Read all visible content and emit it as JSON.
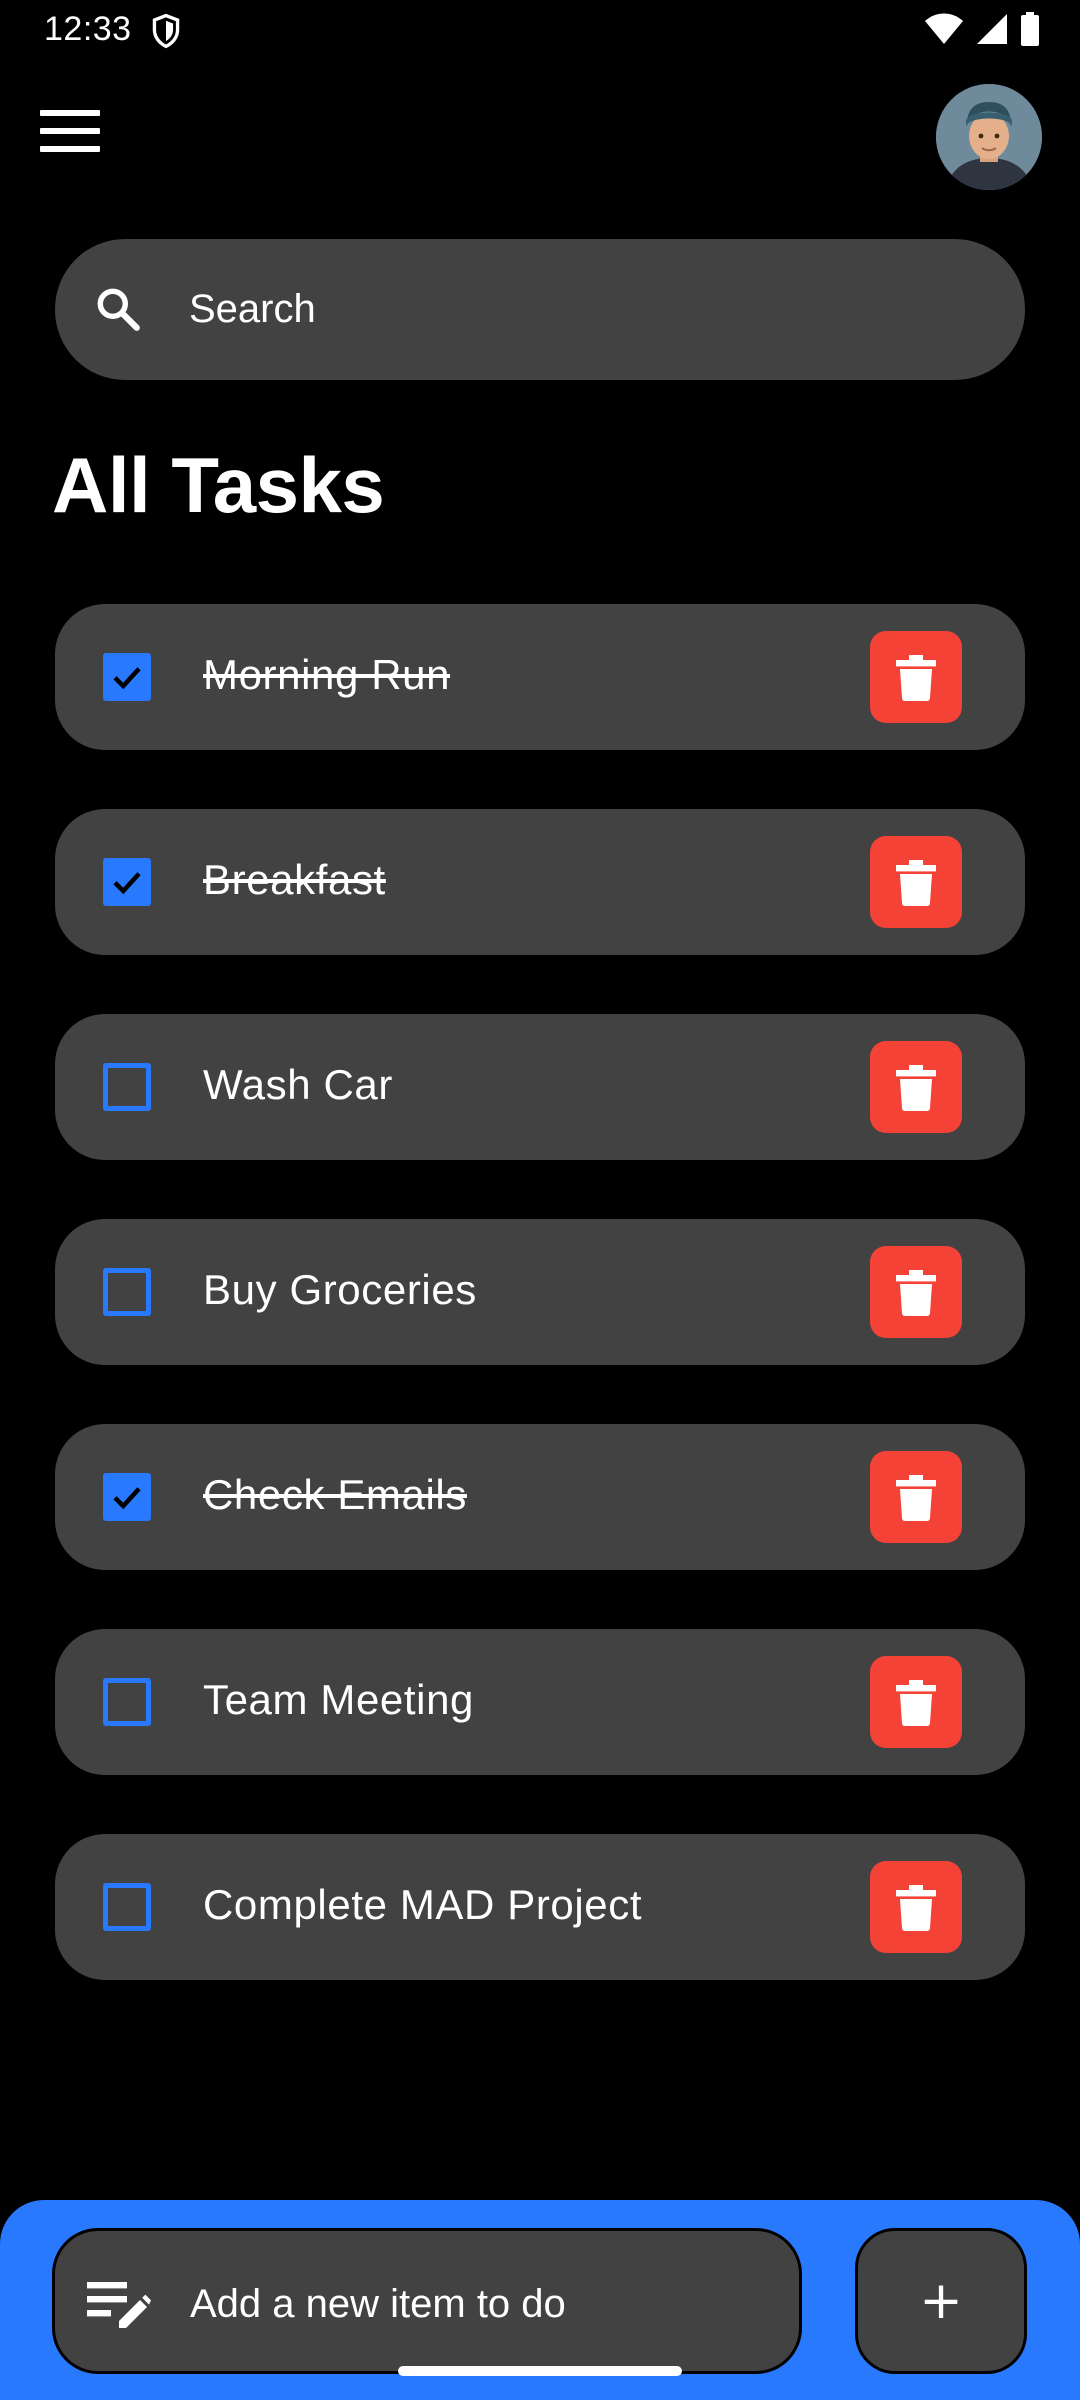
{
  "status_bar": {
    "time": "12:33"
  },
  "header": {
    "menu_icon": "menu-icon",
    "avatar": "user-avatar"
  },
  "search": {
    "placeholder": "Search",
    "icon": "search-icon"
  },
  "section_title": "All Tasks",
  "tasks": [
    {
      "label": "Morning Run",
      "done": true
    },
    {
      "label": "Breakfast",
      "done": true
    },
    {
      "label": "Wash Car",
      "done": false
    },
    {
      "label": "Buy Groceries",
      "done": false
    },
    {
      "label": "Check Emails",
      "done": true
    },
    {
      "label": "Team Meeting",
      "done": false
    },
    {
      "label": "Complete MAD Project",
      "done": false
    }
  ],
  "add_item": {
    "placeholder": "Add a new item to do",
    "icon": "edit-note-icon",
    "button_label": "+"
  },
  "colors": {
    "background": "#000000",
    "card": "#424242",
    "accent": "#2979ff",
    "delete": "#f44336"
  }
}
